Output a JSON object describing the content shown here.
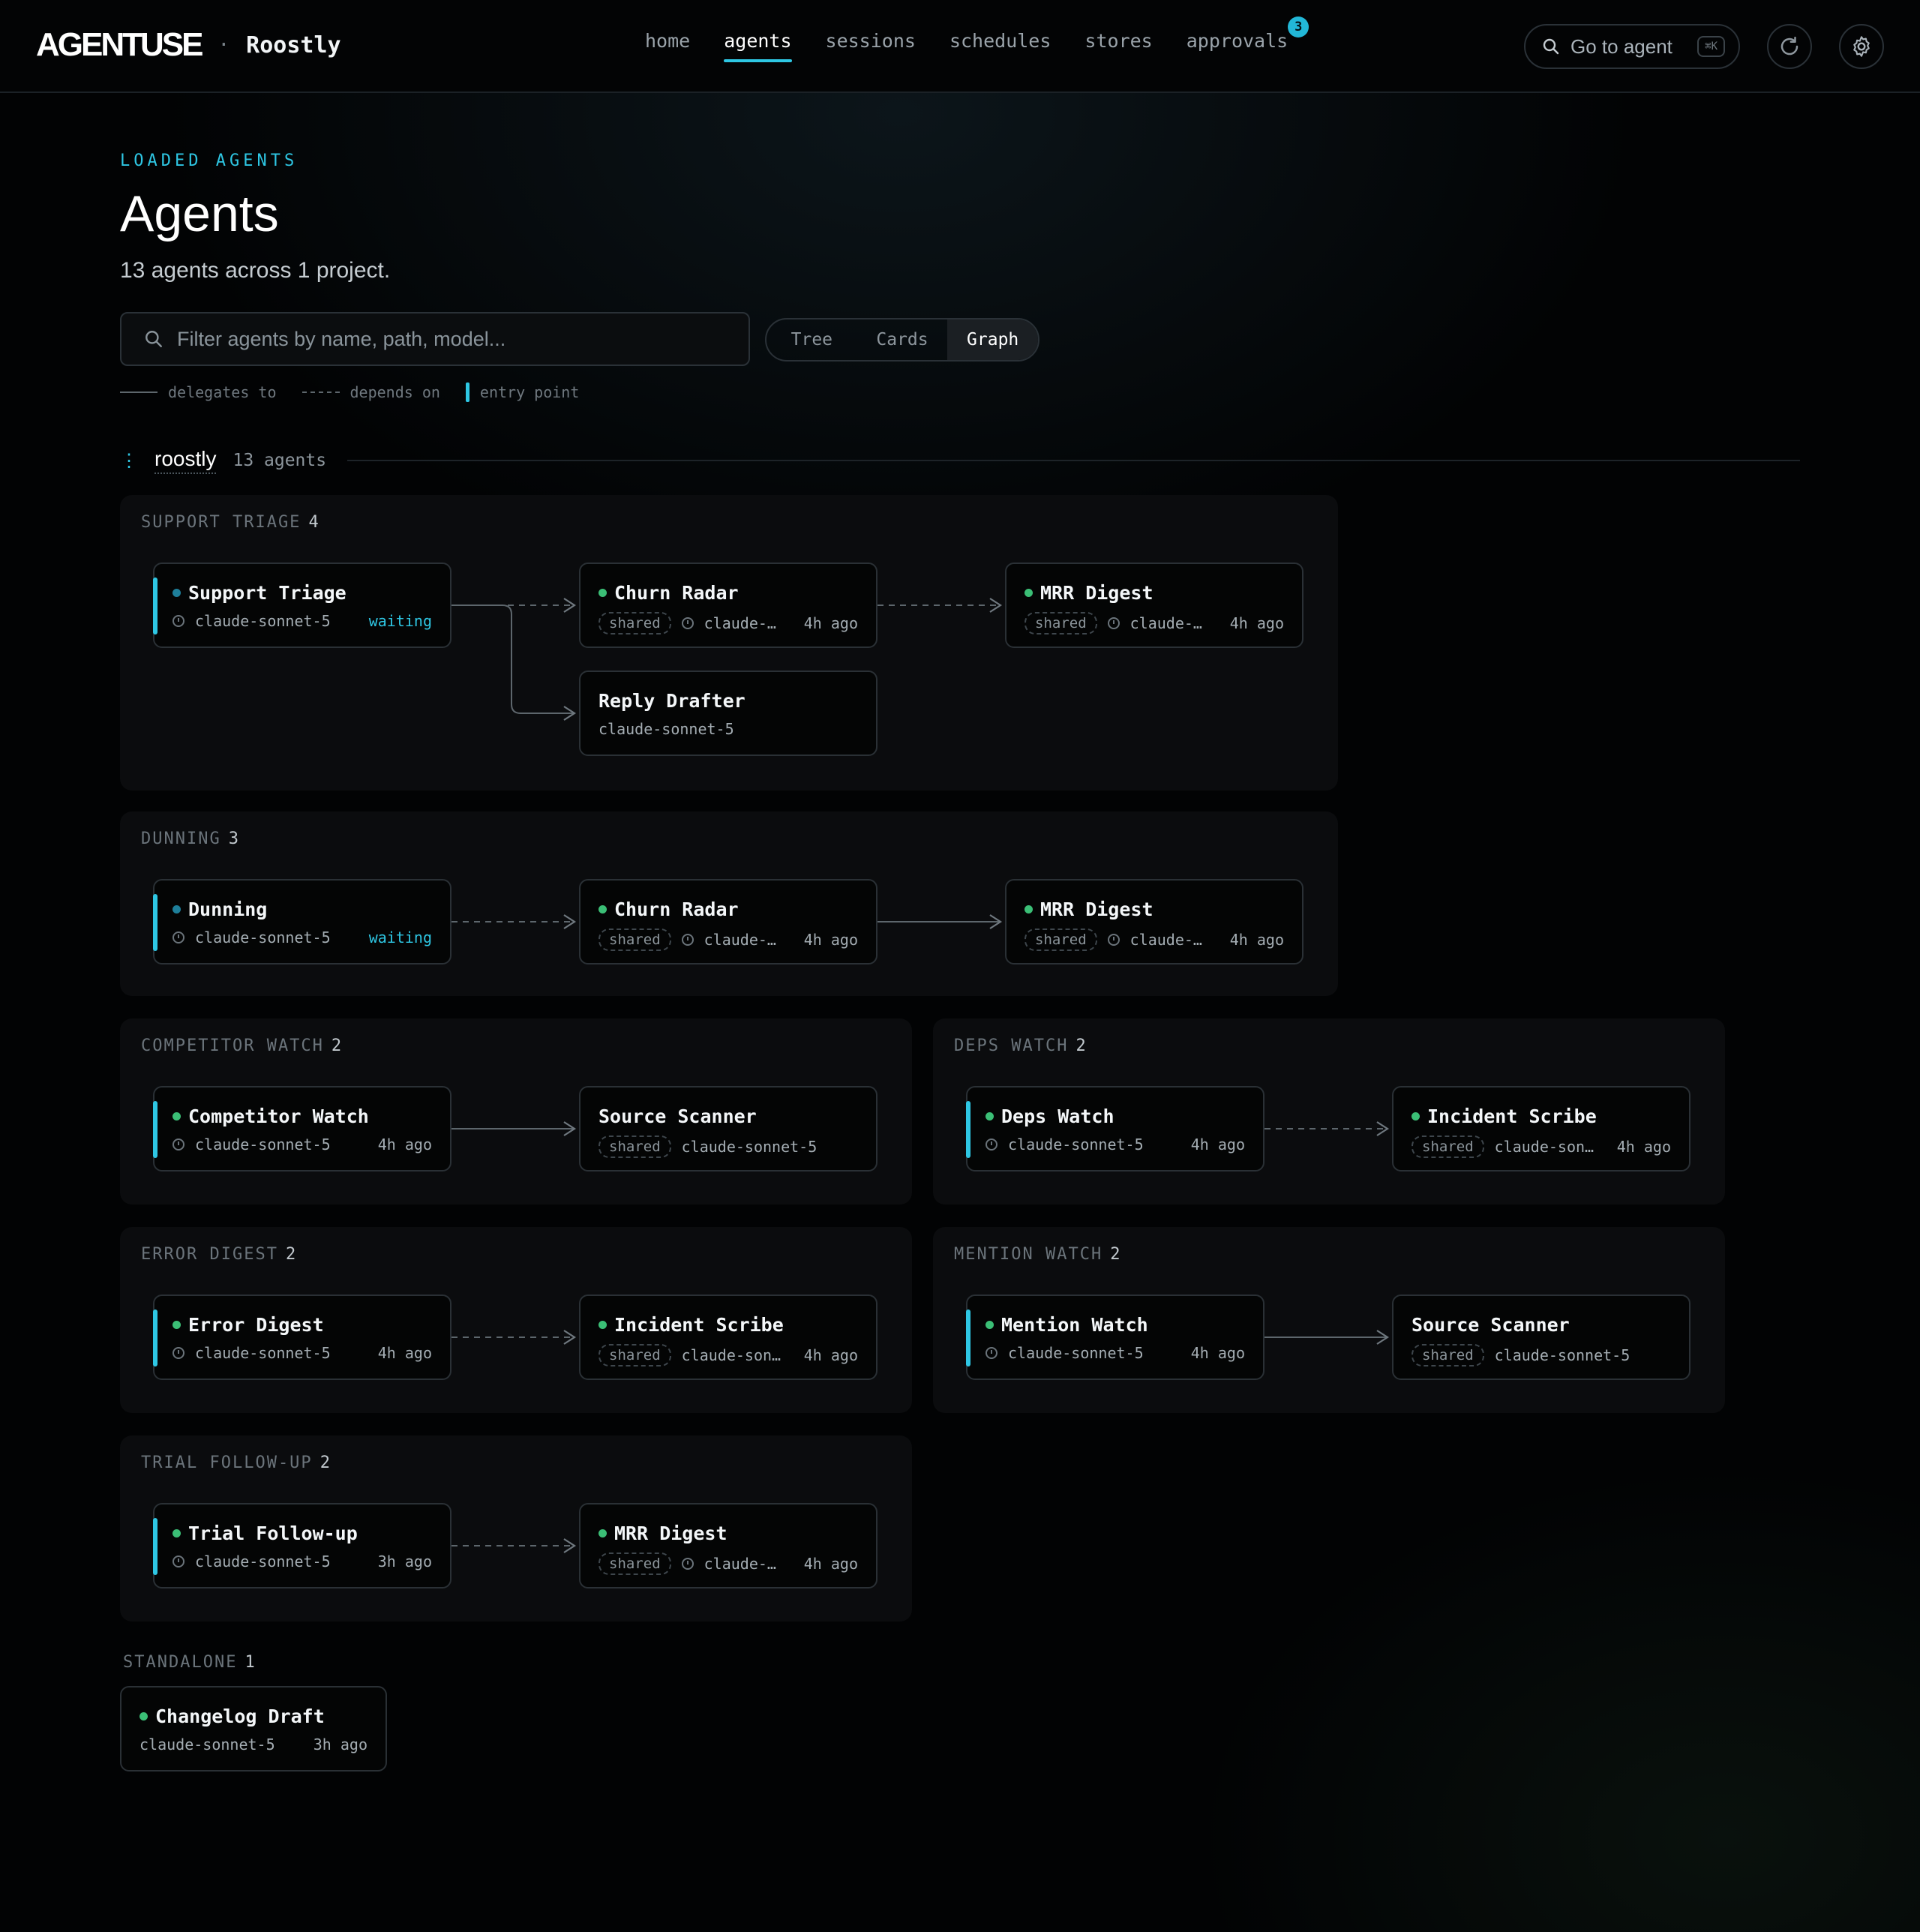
{
  "brand": {
    "logo": "AGENTUSE",
    "separator": "·",
    "project": "Roostly"
  },
  "nav": {
    "items": [
      "home",
      "agents",
      "sessions",
      "schedules",
      "stores",
      "approvals"
    ],
    "active": "agents",
    "approvals_badge": "3"
  },
  "goto": {
    "label": "Go to agent",
    "shortcut": "⌘K"
  },
  "header": {
    "eyebrow": "LOADED AGENTS",
    "title": "Agents",
    "subtitle": "13 agents across 1 project."
  },
  "filter": {
    "placeholder": "Filter agents by name, path, model..."
  },
  "view_toggle": {
    "options": [
      "Tree",
      "Cards",
      "Graph"
    ],
    "active": "Graph"
  },
  "legend": {
    "delegates": "delegates to",
    "depends": "depends on",
    "entry": "entry point"
  },
  "project": {
    "dots": "⋮",
    "name": "roostly",
    "count": "13 agents"
  },
  "colors": {
    "accent": "#2ec7e4",
    "status_green": "#3bbf76",
    "status_teal": "#1e7f9a",
    "background": "#020304"
  },
  "groups": [
    {
      "label": "SUPPORT TRIAGE",
      "count": "4",
      "nodes": [
        {
          "name": "Support Triage",
          "entry": true,
          "dot": "teal",
          "shared": false,
          "model": "claude-sonnet-5",
          "status": "waiting",
          "clock": true
        },
        {
          "name": "Churn Radar",
          "entry": false,
          "dot": "green",
          "shared": true,
          "model": "claude-…",
          "status": "4h ago",
          "clock": true
        },
        {
          "name": "MRR Digest",
          "entry": false,
          "dot": "green",
          "shared": true,
          "model": "claude-…",
          "status": "4h ago",
          "clock": true
        },
        {
          "name": "Reply Drafter",
          "entry": false,
          "dot": "none",
          "shared": false,
          "model": "claude-sonnet-5",
          "status": "",
          "clock": false
        }
      ],
      "edges": [
        {
          "from": "Support Triage",
          "to": "Churn Radar",
          "type": "depends"
        },
        {
          "from": "Churn Radar",
          "to": "MRR Digest",
          "type": "depends"
        },
        {
          "from": "Support Triage",
          "to": "Reply Drafter",
          "type": "delegates"
        }
      ]
    },
    {
      "label": "DUNNING",
      "count": "3",
      "nodes": [
        {
          "name": "Dunning",
          "entry": true,
          "dot": "teal",
          "shared": false,
          "model": "claude-sonnet-5",
          "status": "waiting",
          "clock": true
        },
        {
          "name": "Churn Radar",
          "entry": false,
          "dot": "green",
          "shared": true,
          "model": "claude-…",
          "status": "4h ago",
          "clock": true
        },
        {
          "name": "MRR Digest",
          "entry": false,
          "dot": "green",
          "shared": true,
          "model": "claude-…",
          "status": "4h ago",
          "clock": true
        }
      ],
      "edges": [
        {
          "from": "Dunning",
          "to": "Churn Radar",
          "type": "depends"
        },
        {
          "from": "Churn Radar",
          "to": "MRR Digest",
          "type": "delegates"
        }
      ]
    },
    {
      "label": "COMPETITOR WATCH",
      "count": "2",
      "nodes": [
        {
          "name": "Competitor Watch",
          "entry": true,
          "dot": "green",
          "shared": false,
          "model": "claude-sonnet-5",
          "status": "4h ago",
          "clock": true
        },
        {
          "name": "Source Scanner",
          "entry": false,
          "dot": "none",
          "shared": true,
          "model": "claude-sonnet-5",
          "status": "",
          "clock": false
        }
      ],
      "edges": [
        {
          "from": "Competitor Watch",
          "to": "Source Scanner",
          "type": "delegates"
        }
      ]
    },
    {
      "label": "DEPS WATCH",
      "count": "2",
      "nodes": [
        {
          "name": "Deps Watch",
          "entry": true,
          "dot": "green",
          "shared": false,
          "model": "claude-sonnet-5",
          "status": "4h ago",
          "clock": true
        },
        {
          "name": "Incident Scribe",
          "entry": false,
          "dot": "green",
          "shared": true,
          "model": "claude-son…",
          "status": "4h ago",
          "clock": false
        }
      ],
      "edges": [
        {
          "from": "Deps Watch",
          "to": "Incident Scribe",
          "type": "depends"
        }
      ]
    },
    {
      "label": "ERROR DIGEST",
      "count": "2",
      "nodes": [
        {
          "name": "Error Digest",
          "entry": true,
          "dot": "green",
          "shared": false,
          "model": "claude-sonnet-5",
          "status": "4h ago",
          "clock": true
        },
        {
          "name": "Incident Scribe",
          "entry": false,
          "dot": "green",
          "shared": true,
          "model": "claude-son…",
          "status": "4h ago",
          "clock": false
        }
      ],
      "edges": [
        {
          "from": "Error Digest",
          "to": "Incident Scribe",
          "type": "depends"
        }
      ]
    },
    {
      "label": "MENTION WATCH",
      "count": "2",
      "nodes": [
        {
          "name": "Mention Watch",
          "entry": true,
          "dot": "green",
          "shared": false,
          "model": "claude-sonnet-5",
          "status": "4h ago",
          "clock": true
        },
        {
          "name": "Source Scanner",
          "entry": false,
          "dot": "none",
          "shared": true,
          "model": "claude-sonnet-5",
          "status": "",
          "clock": false
        }
      ],
      "edges": [
        {
          "from": "Mention Watch",
          "to": "Source Scanner",
          "type": "delegates"
        }
      ]
    },
    {
      "label": "TRIAL FOLLOW-UP",
      "count": "2",
      "nodes": [
        {
          "name": "Trial Follow-up",
          "entry": true,
          "dot": "green",
          "shared": false,
          "model": "claude-sonnet-5",
          "status": "3h ago",
          "clock": true
        },
        {
          "name": "MRR Digest",
          "entry": false,
          "dot": "green",
          "shared": true,
          "model": "claude-…",
          "status": "4h ago",
          "clock": true
        }
      ],
      "edges": [
        {
          "from": "Trial Follow-up",
          "to": "MRR Digest",
          "type": "depends"
        }
      ]
    }
  ],
  "standalone": {
    "label": "STANDALONE",
    "count": "1",
    "node": {
      "name": "Changelog Draft",
      "dot": "green",
      "model": "claude-sonnet-5",
      "status": "3h ago"
    }
  }
}
